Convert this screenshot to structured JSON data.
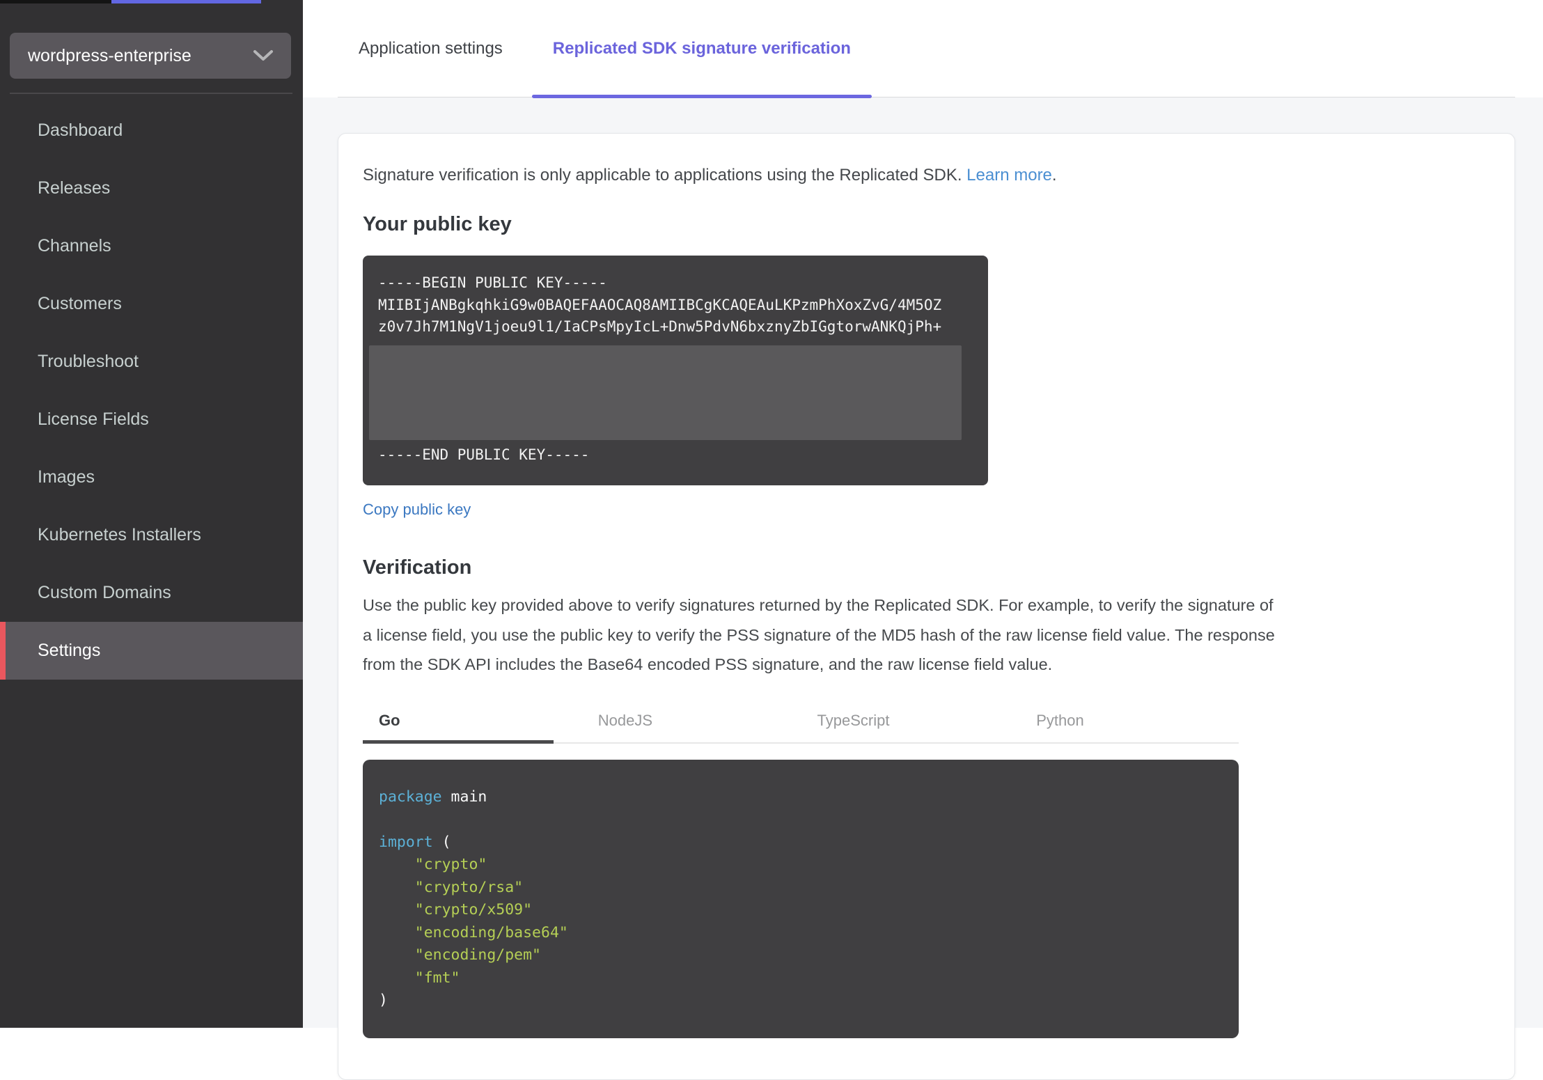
{
  "colors": {
    "accent_purple": "#6c67e0",
    "sidebar_bg": "#323133",
    "sidebar_active_bg": "#5a575c",
    "sidebar_active_bar": "#e9575e",
    "link_blue": "#4b8fd2",
    "copy_link_blue": "#3b78c1",
    "code_bg": "#403f41",
    "code_keyword": "#5cb1d7",
    "code_string": "#b5cf55",
    "top_sliver_blue": "#6267e2"
  },
  "sidebar": {
    "app_selector": {
      "label": "wordpress-enterprise",
      "chevron_icon": "chevron-down"
    },
    "items": [
      {
        "label": "Dashboard",
        "active": false
      },
      {
        "label": "Releases",
        "active": false
      },
      {
        "label": "Channels",
        "active": false
      },
      {
        "label": "Customers",
        "active": false
      },
      {
        "label": "Troubleshoot",
        "active": false
      },
      {
        "label": "License Fields",
        "active": false
      },
      {
        "label": "Images",
        "active": false
      },
      {
        "label": "Kubernetes Installers",
        "active": false
      },
      {
        "label": "Custom Domains",
        "active": false
      },
      {
        "label": "Settings",
        "active": true
      }
    ]
  },
  "main": {
    "tabs": [
      {
        "label": "Application settings",
        "active": false
      },
      {
        "label": "Replicated SDK signature verification",
        "active": true
      }
    ],
    "intro": {
      "text": "Signature verification is only applicable to applications using the Replicated SDK.",
      "link": "Learn more",
      "suffix": "."
    },
    "public_key": {
      "heading": "Your public key",
      "lines_top": [
        "-----BEGIN PUBLIC KEY-----",
        "MIIBIjANBgkqhkiG9w0BAQEFAAOCAQ8AMIIBCgKCAQEAuLKPzmPhXoxZvG/4M5OZ",
        "z0v7Jh7M1NgV1joeu9l1/IaCPsMpyIcL+Dnw5PdvN6bxznyZbIGgtorwANKQjPh+"
      ],
      "redacted_lines": 5,
      "line_end": "-----END PUBLIC KEY-----",
      "copy_label": "Copy public key"
    },
    "verification": {
      "heading": "Verification",
      "paragraph": "Use the public key provided above to verify signatures returned by the Replicated SDK. For example, to verify the signature of a license field, you use the public key to verify the PSS signature of the MD5 hash of the raw license field value. The response from the SDK API includes the Base64 encoded PSS signature, and the raw license field value."
    },
    "lang_tabs": [
      {
        "label": "Go",
        "active": true
      },
      {
        "label": "NodeJS",
        "active": false
      },
      {
        "label": "TypeScript",
        "active": false
      },
      {
        "label": "Python",
        "active": false
      }
    ],
    "code": {
      "lines": [
        [
          [
            "kw",
            "package"
          ],
          [
            "pl",
            " main"
          ]
        ],
        [],
        [
          [
            "kw",
            "import"
          ],
          [
            "pl",
            " ("
          ]
        ],
        [
          [
            "pl",
            "    "
          ],
          [
            "str",
            "\"crypto\""
          ]
        ],
        [
          [
            "pl",
            "    "
          ],
          [
            "str",
            "\"crypto/rsa\""
          ]
        ],
        [
          [
            "pl",
            "    "
          ],
          [
            "str",
            "\"crypto/x509\""
          ]
        ],
        [
          [
            "pl",
            "    "
          ],
          [
            "str",
            "\"encoding/base64\""
          ]
        ],
        [
          [
            "pl",
            "    "
          ],
          [
            "str",
            "\"encoding/pem\""
          ]
        ],
        [
          [
            "pl",
            "    "
          ],
          [
            "str",
            "\"fmt\""
          ]
        ],
        [
          [
            "pl",
            ")"
          ]
        ]
      ]
    }
  }
}
